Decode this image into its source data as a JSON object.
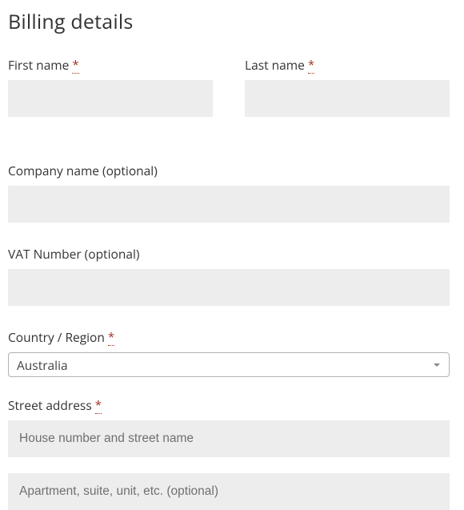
{
  "heading": "Billing details",
  "required_mark": "*",
  "first_name": {
    "label": "First name ",
    "value": ""
  },
  "last_name": {
    "label": "Last name ",
    "value": ""
  },
  "company": {
    "label": "Company name (optional)",
    "value": ""
  },
  "vat": {
    "label": "VAT Number (optional)",
    "value": ""
  },
  "country": {
    "label": "Country / Region ",
    "selected": "Australia"
  },
  "street": {
    "label": "Street address ",
    "placeholder1": "House number and street name",
    "placeholder2": "Apartment, suite, unit, etc. (optional)"
  }
}
